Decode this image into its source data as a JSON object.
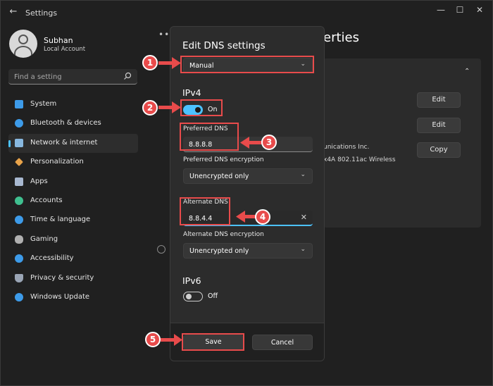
{
  "window": {
    "app_title": "Settings",
    "back_icon": "back-arrow-icon",
    "controls": [
      "minimize-icon",
      "maximize-icon",
      "close-icon"
    ]
  },
  "profile": {
    "name": "Subhan",
    "account_type": "Local Account"
  },
  "search": {
    "placeholder": "Find a setting"
  },
  "sidebar": {
    "items": [
      {
        "label": "System",
        "icon": "monitor-icon",
        "color": "#3d9be9"
      },
      {
        "label": "Bluetooth & devices",
        "icon": "bluetooth-icon",
        "color": "#3d9be9"
      },
      {
        "label": "Network & internet",
        "icon": "wifi-icon",
        "color": "#88b8e0",
        "active": true
      },
      {
        "label": "Personalization",
        "icon": "brush-icon",
        "color": "#e8a34a"
      },
      {
        "label": "Apps",
        "icon": "apps-icon",
        "color": "#a8b8d0"
      },
      {
        "label": "Accounts",
        "icon": "person-icon",
        "color": "#3fbf8f"
      },
      {
        "label": "Time & language",
        "icon": "globe-clock-icon",
        "color": "#3d9be9"
      },
      {
        "label": "Gaming",
        "icon": "gamepad-icon",
        "color": "#b0b0b0"
      },
      {
        "label": "Accessibility",
        "icon": "accessibility-icon",
        "color": "#3d9be9"
      },
      {
        "label": "Privacy & security",
        "icon": "shield-icon",
        "color": "#9aa5b5"
      },
      {
        "label": "Windows Update",
        "icon": "update-icon",
        "color": "#3d9be9"
      }
    ]
  },
  "background": {
    "dots": "•••",
    "title_fragment": "erties",
    "edit_label_1": "Edit",
    "edit_label_2": "Edit",
    "copy_label": "Copy",
    "text_1": "unications Inc.",
    "text_2": "x4A 802.11ac Wireless"
  },
  "dialog": {
    "title": "Edit DNS settings",
    "mode_select": "Manual",
    "ipv4": {
      "heading": "IPv4",
      "toggle_state": "On",
      "preferred_label": "Preferred DNS",
      "preferred_value": "8.8.8.8",
      "preferred_enc_label": "Preferred DNS encryption",
      "preferred_enc_value": "Unencrypted only",
      "alternate_label": "Alternate DNS",
      "alternate_value": "8.8.4.4",
      "alternate_enc_label": "Alternate DNS encryption",
      "alternate_enc_value": "Unencrypted only"
    },
    "ipv6": {
      "heading": "IPv6",
      "toggle_state": "Off"
    },
    "save_label": "Save",
    "cancel_label": "Cancel"
  },
  "annotations": {
    "steps": [
      "1",
      "2",
      "3",
      "4",
      "5"
    ],
    "color": "#e84b4b"
  }
}
